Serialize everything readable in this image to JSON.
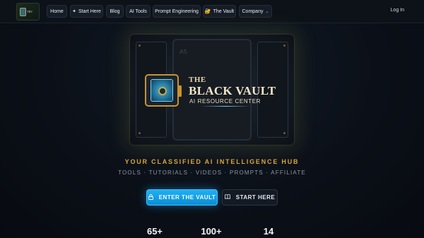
{
  "nav": {
    "logo_text": "TBV",
    "items": [
      {
        "label": "Home",
        "icon": ""
      },
      {
        "label": "Start Here",
        "icon": "sparkle-icon"
      },
      {
        "label": "Blog",
        "icon": ""
      },
      {
        "label": "AI Tools",
        "icon": ""
      },
      {
        "label": "Prompt Engineering",
        "icon": ""
      },
      {
        "label": "The Vault",
        "icon": "lock-key-emoji-icon"
      },
      {
        "label": "Company",
        "icon": "chevron-down-icon"
      }
    ],
    "login_label": "Log In"
  },
  "hero": {
    "title_line1": "THE",
    "title_line2": "BLACK VAULT",
    "subtitle": "AI RESOURCE CENTER",
    "bg_glyph": "AS"
  },
  "tagline": "YOUR CLASSIFIED AI INTELLIGENCE HUB",
  "subtagline": "TOOLS · TUTORIALS · VIDEOS · PROMPTS · AFFILIATE",
  "buttons": {
    "primary_label": "ENTER THE VAULT",
    "secondary_label": "START HERE"
  },
  "stats": [
    "65+",
    "100+",
    "14"
  ],
  "colors": {
    "accent_gold": "#d9a43a",
    "accent_blue": "#0b8ed6",
    "background": "#0b1018"
  }
}
